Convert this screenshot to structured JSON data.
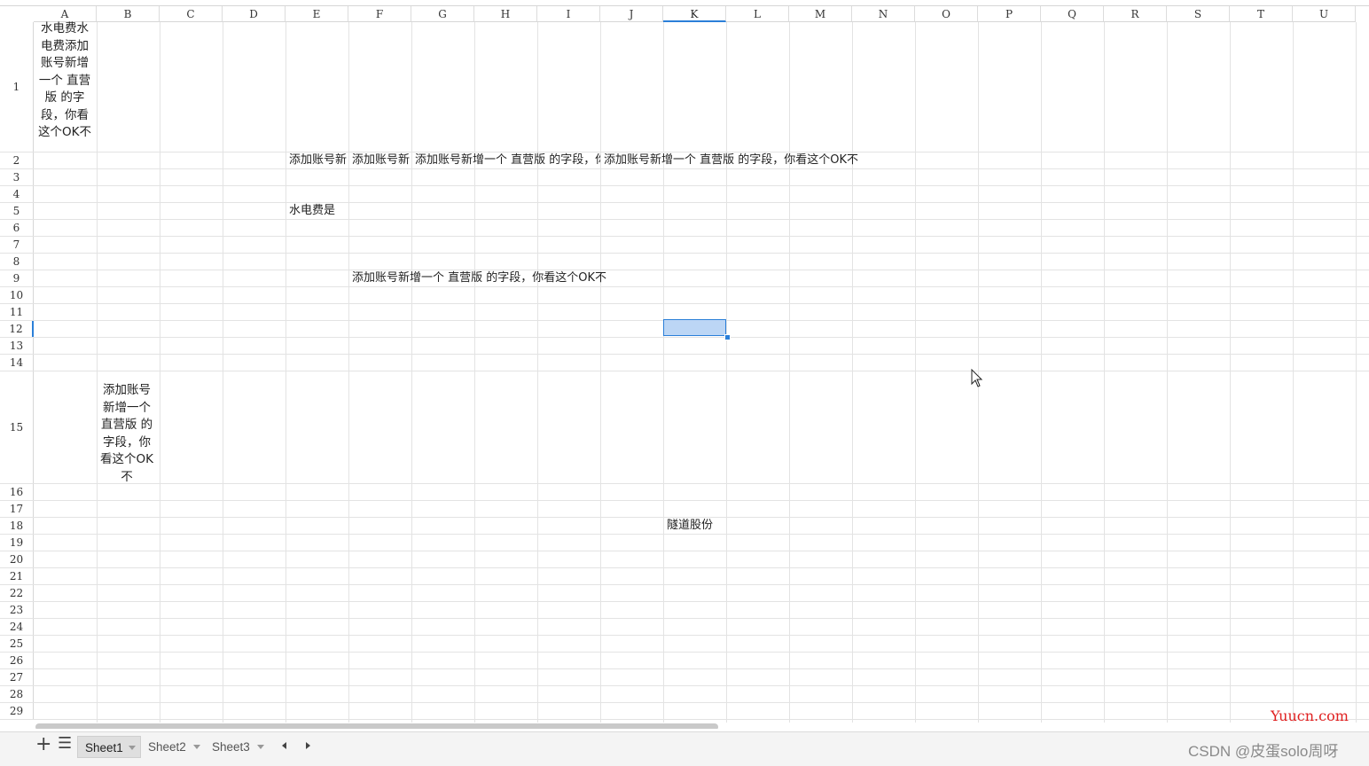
{
  "columns": [
    "A",
    "B",
    "C",
    "D",
    "E",
    "F",
    "G",
    "H",
    "I",
    "J",
    "K",
    "L",
    "M",
    "N",
    "O",
    "P",
    "Q",
    "R",
    "S",
    "T",
    "U"
  ],
  "rows": [
    "1",
    "2",
    "3",
    "4",
    "5",
    "6",
    "7",
    "8",
    "9",
    "10",
    "11",
    "12",
    "13",
    "14",
    "15",
    "16",
    "17",
    "18",
    "19",
    "20",
    "21",
    "22",
    "23",
    "24",
    "25",
    "26",
    "27",
    "28",
    "29"
  ],
  "active_cell": {
    "column": "K",
    "row": "12"
  },
  "cells": {
    "A1": "水电费水电费添加账号新增一个 直营版 的字段，你看这个OK不",
    "E2": "添加账号新",
    "F2": "添加账号新",
    "G2": "添加账号新增一个 直营版 的字段，你",
    "J2": "添加账号新增一个 直营版 的字段，你看这个OK不",
    "E5": "水电费是",
    "F9": "添加账号新增一个 直营版 的字段，你看这个OK不",
    "B15": "添加账号新增一个 直营版 的字段，你看这个OK不",
    "K18": "隧道股份"
  },
  "sheet_tabs": [
    {
      "label": "Sheet1",
      "active": true
    },
    {
      "label": "Sheet2",
      "active": false
    },
    {
      "label": "Sheet3",
      "active": false
    }
  ],
  "toolbar": {
    "add_icon": "plus-icon",
    "list_icon": "menu-icon"
  },
  "watermarks": {
    "site": "Yuucn.com",
    "author": "CSDN @皮蛋solo周呀"
  },
  "colors": {
    "selection": "#bcd6f5",
    "accent": "#2b7fd8",
    "watermark_site": "#e02020"
  }
}
